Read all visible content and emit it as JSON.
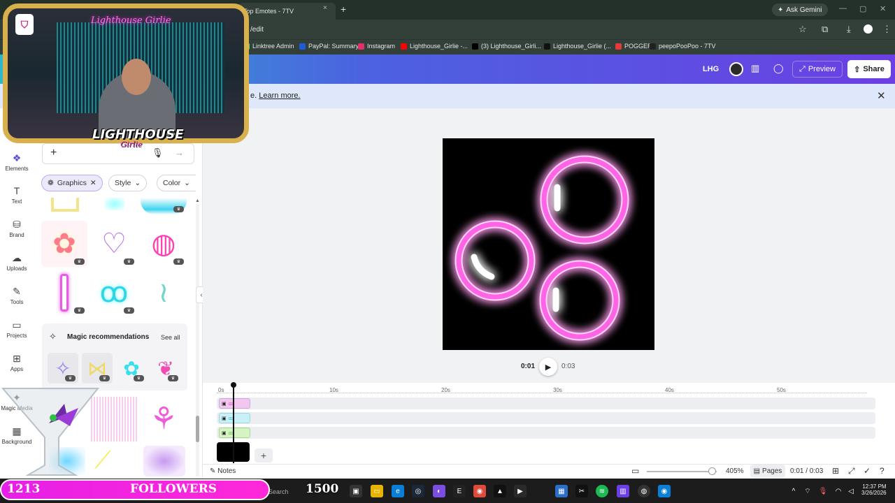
{
  "browser": {
    "tab_title": "Top Emotes - 7TV",
    "tab_close": "×",
    "new_tab": "+",
    "ask_gemini": "Ask Gemini",
    "url": "/edit",
    "bookmarks": [
      {
        "label": "Linktree Admin",
        "color": "#43e55e"
      },
      {
        "label": "PayPal: Summary",
        "color": "#1c5cd8"
      },
      {
        "label": "Instagram",
        "color": "#e1306c"
      },
      {
        "label": "Lighthouse_Girlie -...",
        "color": "#ff0000"
      },
      {
        "label": "(3) Lighthouse_Girli...",
        "color": "#000000"
      },
      {
        "label": "Lighthouse_Girlie (...",
        "color": "#111111"
      },
      {
        "label": "POGGERS",
        "color": "#e33b3b"
      },
      {
        "label": "peepoPooPoo - 7TV",
        "color": "#222222"
      }
    ]
  },
  "header": {
    "initials": "LHG",
    "preview_label": "Preview",
    "share_label": "Share"
  },
  "banner": {
    "text_prefix": "e.",
    "learn_more": "Learn more.",
    "close": "✕"
  },
  "sidebar": {
    "items": [
      {
        "label": "Elements",
        "icon": "elements-icon",
        "glyph": "❖"
      },
      {
        "label": "Text",
        "icon": "text-icon",
        "glyph": "T"
      },
      {
        "label": "Brand",
        "icon": "brand-icon",
        "glyph": "⛁"
      },
      {
        "label": "Uploads",
        "icon": "cloud-upload-icon",
        "glyph": "☁"
      },
      {
        "label": "Tools",
        "icon": "pen-icon",
        "glyph": "✎"
      },
      {
        "label": "Projects",
        "icon": "folder-icon",
        "glyph": "▭"
      },
      {
        "label": "Apps",
        "icon": "apps-icon",
        "glyph": "⊞"
      },
      {
        "label": "Magic Media",
        "icon": "magic-media-icon",
        "glyph": "✦"
      },
      {
        "label": "Background",
        "icon": "background-icon",
        "glyph": "▦"
      }
    ]
  },
  "panel": {
    "chips": {
      "graphics": "Graphics",
      "style": "Style",
      "color": "Color"
    },
    "magic_title": "Magic recommendations",
    "see_all": "See all"
  },
  "playback": {
    "current": "0:01",
    "total": "0:03"
  },
  "timeline": {
    "ruler": [
      "0s",
      "10s",
      "20s",
      "30s",
      "40s",
      "50s"
    ]
  },
  "bottom": {
    "notes": "Notes",
    "zoom": "405%",
    "pages": "Pages",
    "page_count": "0:01 / 0:03"
  },
  "stream_overlay": {
    "neon_sign": "Lighthouse Girlie",
    "logo_main": "LIGHTHOUSE",
    "logo_sub": "Girlie",
    "followers_count": "1213",
    "followers_label": "FOLLOWERS",
    "followers_goal": "1500"
  },
  "taskbar": {
    "search_hint": "Search",
    "time": "12:37 PM",
    "date": "3/26/2026"
  },
  "colors": {
    "header_gradient_start": "#2fb7c9",
    "header_gradient_end": "#6b3fe3",
    "neon_pink": "#ff5ce0",
    "follower_bar": "#e620e6"
  }
}
